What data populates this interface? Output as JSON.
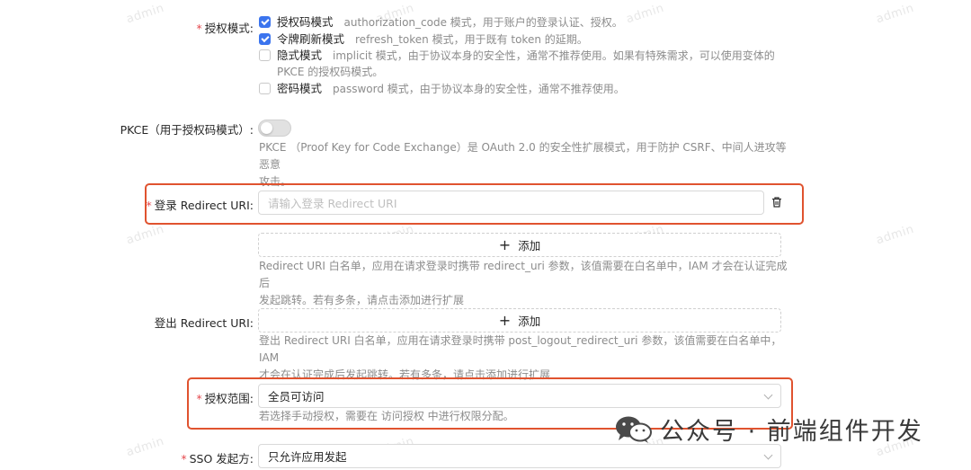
{
  "watermark": "admin",
  "grant": {
    "label": "授权模式",
    "options": [
      {
        "name": "授权码模式",
        "desc": "authorization_code 模式，用于账户的登录认证、授权。",
        "checked": true
      },
      {
        "name": "令牌刷新模式",
        "desc": "refresh_token 模式，用于既有 token 的延期。",
        "checked": true
      },
      {
        "name": "隐式模式",
        "desc": "implicit 模式，由于协议本身的安全性，通常不推荐使用。如果有特殊需求，可以使用变体的",
        "desc2": "PKCE 的授权码模式。",
        "checked": false
      },
      {
        "name": "密码模式",
        "desc": "password 模式，由于协议本身的安全性，通常不推荐使用。",
        "checked": false
      }
    ]
  },
  "pkce": {
    "label": "PKCE（用于授权码模式）:",
    "enabled": false,
    "help1": "PKCE （Proof Key for Code Exchange）是 OAuth 2.0 的安全性扩展模式，用于防护 CSRF、中间人进攻等恶意",
    "help2": "攻击。"
  },
  "login_redirect": {
    "label": "登录 Redirect URI:",
    "placeholder": "请输入登录 Redirect URI",
    "add_label": "添加",
    "help1": "Redirect URI 白名单，应用在请求登录时携带 redirect_uri 参数，该值需要在白名单中，IAM 才会在认证完成后",
    "help2": "发起跳转。若有多条，请点击添加进行扩展"
  },
  "logout_redirect": {
    "label": "登出 Redirect URI:",
    "add_label": "添加",
    "help1": "登出 Redirect URI 白名单，应用在请求登录时携带 post_logout_redirect_uri 参数，该值需要在白名单中，IAM",
    "help2": "才会在认证完成后发起跳转。若有多条，请点击添加进行扩展"
  },
  "scope": {
    "label": "授权范围:",
    "value": "全员可访问",
    "help": "若选择手动授权，需要在 访问授权 中进行权限分配。"
  },
  "sso": {
    "label": "SSO 发起方:",
    "value": "只允许应用发起"
  },
  "brand": {
    "text": "公众号 · 前端组件开发"
  },
  "colors": {
    "primary": "#3b74ee",
    "highlight": "#e0532f",
    "required": "#e5484d"
  }
}
